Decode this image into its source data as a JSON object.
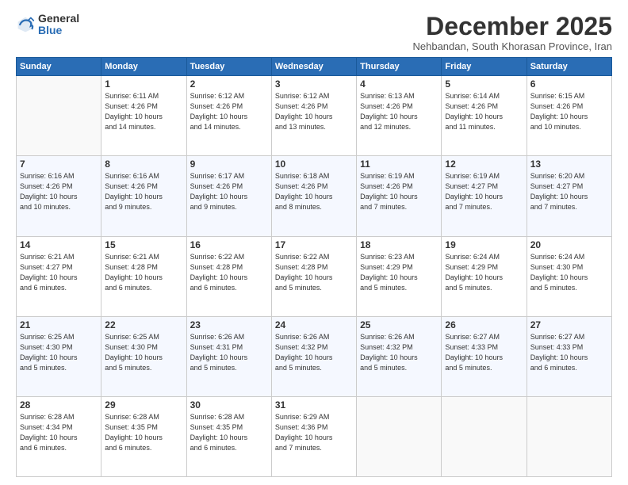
{
  "logo": {
    "general": "General",
    "blue": "Blue"
  },
  "header": {
    "month": "December 2025",
    "location": "Nehbandan, South Khorasan Province, Iran"
  },
  "weekdays": [
    "Sunday",
    "Monday",
    "Tuesday",
    "Wednesday",
    "Thursday",
    "Friday",
    "Saturday"
  ],
  "weeks": [
    [
      {
        "day": "",
        "info": ""
      },
      {
        "day": "1",
        "info": "Sunrise: 6:11 AM\nSunset: 4:26 PM\nDaylight: 10 hours\nand 14 minutes."
      },
      {
        "day": "2",
        "info": "Sunrise: 6:12 AM\nSunset: 4:26 PM\nDaylight: 10 hours\nand 14 minutes."
      },
      {
        "day": "3",
        "info": "Sunrise: 6:12 AM\nSunset: 4:26 PM\nDaylight: 10 hours\nand 13 minutes."
      },
      {
        "day": "4",
        "info": "Sunrise: 6:13 AM\nSunset: 4:26 PM\nDaylight: 10 hours\nand 12 minutes."
      },
      {
        "day": "5",
        "info": "Sunrise: 6:14 AM\nSunset: 4:26 PM\nDaylight: 10 hours\nand 11 minutes."
      },
      {
        "day": "6",
        "info": "Sunrise: 6:15 AM\nSunset: 4:26 PM\nDaylight: 10 hours\nand 10 minutes."
      }
    ],
    [
      {
        "day": "7",
        "info": "Sunrise: 6:16 AM\nSunset: 4:26 PM\nDaylight: 10 hours\nand 10 minutes."
      },
      {
        "day": "8",
        "info": "Sunrise: 6:16 AM\nSunset: 4:26 PM\nDaylight: 10 hours\nand 9 minutes."
      },
      {
        "day": "9",
        "info": "Sunrise: 6:17 AM\nSunset: 4:26 PM\nDaylight: 10 hours\nand 9 minutes."
      },
      {
        "day": "10",
        "info": "Sunrise: 6:18 AM\nSunset: 4:26 PM\nDaylight: 10 hours\nand 8 minutes."
      },
      {
        "day": "11",
        "info": "Sunrise: 6:19 AM\nSunset: 4:26 PM\nDaylight: 10 hours\nand 7 minutes."
      },
      {
        "day": "12",
        "info": "Sunrise: 6:19 AM\nSunset: 4:27 PM\nDaylight: 10 hours\nand 7 minutes."
      },
      {
        "day": "13",
        "info": "Sunrise: 6:20 AM\nSunset: 4:27 PM\nDaylight: 10 hours\nand 7 minutes."
      }
    ],
    [
      {
        "day": "14",
        "info": "Sunrise: 6:21 AM\nSunset: 4:27 PM\nDaylight: 10 hours\nand 6 minutes."
      },
      {
        "day": "15",
        "info": "Sunrise: 6:21 AM\nSunset: 4:28 PM\nDaylight: 10 hours\nand 6 minutes."
      },
      {
        "day": "16",
        "info": "Sunrise: 6:22 AM\nSunset: 4:28 PM\nDaylight: 10 hours\nand 6 minutes."
      },
      {
        "day": "17",
        "info": "Sunrise: 6:22 AM\nSunset: 4:28 PM\nDaylight: 10 hours\nand 5 minutes."
      },
      {
        "day": "18",
        "info": "Sunrise: 6:23 AM\nSunset: 4:29 PM\nDaylight: 10 hours\nand 5 minutes."
      },
      {
        "day": "19",
        "info": "Sunrise: 6:24 AM\nSunset: 4:29 PM\nDaylight: 10 hours\nand 5 minutes."
      },
      {
        "day": "20",
        "info": "Sunrise: 6:24 AM\nSunset: 4:30 PM\nDaylight: 10 hours\nand 5 minutes."
      }
    ],
    [
      {
        "day": "21",
        "info": "Sunrise: 6:25 AM\nSunset: 4:30 PM\nDaylight: 10 hours\nand 5 minutes."
      },
      {
        "day": "22",
        "info": "Sunrise: 6:25 AM\nSunset: 4:30 PM\nDaylight: 10 hours\nand 5 minutes."
      },
      {
        "day": "23",
        "info": "Sunrise: 6:26 AM\nSunset: 4:31 PM\nDaylight: 10 hours\nand 5 minutes."
      },
      {
        "day": "24",
        "info": "Sunrise: 6:26 AM\nSunset: 4:32 PM\nDaylight: 10 hours\nand 5 minutes."
      },
      {
        "day": "25",
        "info": "Sunrise: 6:26 AM\nSunset: 4:32 PM\nDaylight: 10 hours\nand 5 minutes."
      },
      {
        "day": "26",
        "info": "Sunrise: 6:27 AM\nSunset: 4:33 PM\nDaylight: 10 hours\nand 5 minutes."
      },
      {
        "day": "27",
        "info": "Sunrise: 6:27 AM\nSunset: 4:33 PM\nDaylight: 10 hours\nand 6 minutes."
      }
    ],
    [
      {
        "day": "28",
        "info": "Sunrise: 6:28 AM\nSunset: 4:34 PM\nDaylight: 10 hours\nand 6 minutes."
      },
      {
        "day": "29",
        "info": "Sunrise: 6:28 AM\nSunset: 4:35 PM\nDaylight: 10 hours\nand 6 minutes."
      },
      {
        "day": "30",
        "info": "Sunrise: 6:28 AM\nSunset: 4:35 PM\nDaylight: 10 hours\nand 6 minutes."
      },
      {
        "day": "31",
        "info": "Sunrise: 6:29 AM\nSunset: 4:36 PM\nDaylight: 10 hours\nand 7 minutes."
      },
      {
        "day": "",
        "info": ""
      },
      {
        "day": "",
        "info": ""
      },
      {
        "day": "",
        "info": ""
      }
    ]
  ]
}
